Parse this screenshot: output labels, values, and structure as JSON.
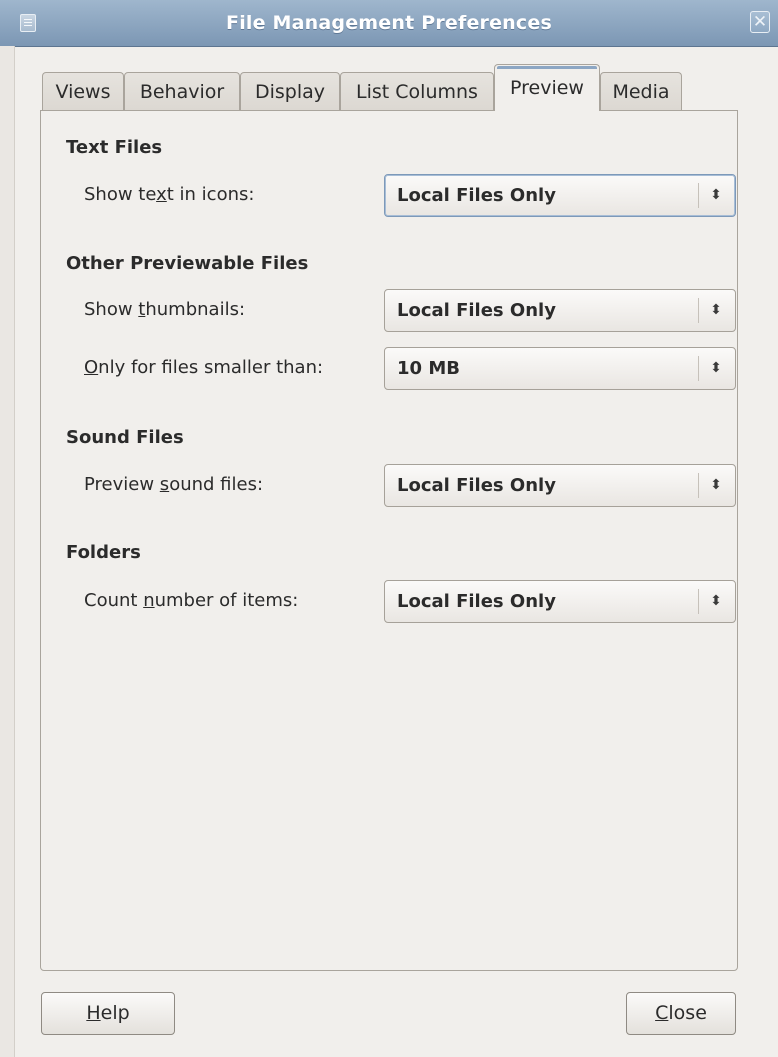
{
  "window": {
    "title": "File Management Preferences"
  },
  "tabs": [
    {
      "label": "Views"
    },
    {
      "label": "Behavior"
    },
    {
      "label": "Display"
    },
    {
      "label": "List Columns"
    },
    {
      "label": "Preview",
      "active": true
    },
    {
      "label": "Media"
    }
  ],
  "sections": {
    "text_files": {
      "title": "Text Files",
      "show_text": {
        "label_pre": "Show te",
        "label_mnemonic": "x",
        "label_post": "t in icons:",
        "value": "Local Files Only"
      }
    },
    "other_files": {
      "title": "Other Previewable Files",
      "thumbnails": {
        "label_pre": "Show ",
        "label_mnemonic": "t",
        "label_post": "humbnails:",
        "value": "Local Files Only"
      },
      "size_limit": {
        "label_pre": "",
        "label_mnemonic": "O",
        "label_post": "nly for files smaller than:",
        "value": "10 MB"
      }
    },
    "sound_files": {
      "title": "Sound Files",
      "preview_sound": {
        "label_pre": "Preview ",
        "label_mnemonic": "s",
        "label_post": "ound files:",
        "value": "Local Files Only"
      }
    },
    "folders": {
      "title": "Folders",
      "count_items": {
        "label_pre": "Count ",
        "label_mnemonic": "n",
        "label_post": "umber of items:",
        "value": "Local Files Only"
      }
    }
  },
  "buttons": {
    "help": {
      "mnemonic": "H",
      "rest": "elp"
    },
    "close": {
      "mnemonic": "C",
      "rest": "lose"
    }
  },
  "icons": {
    "window_menu": "window-menu-icon",
    "close": "close-icon",
    "combo_arrow": "updown-arrow-icon"
  },
  "colors": {
    "titlebar": "#8aa3bf",
    "active_tab_accent": "#8ca6c3",
    "background": "#f1efec"
  }
}
